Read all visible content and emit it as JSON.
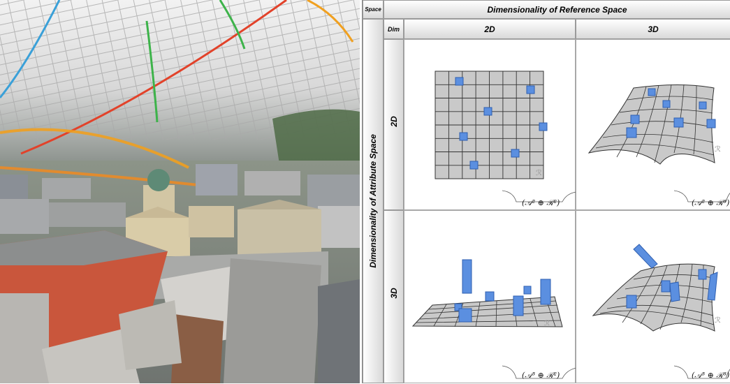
{
  "matrix": {
    "corner_label": "Space",
    "reference_header": "Dimensionality of Reference Space",
    "dim_label": "Dim",
    "attribute_header": "Dimensionality of Attribute Space",
    "columns": [
      "2D",
      "3D"
    ],
    "rows": [
      "2D",
      "3D"
    ],
    "cells": [
      {
        "row": "2D",
        "col": "2D",
        "formula": "(𝒜² ⊕ ℛ²)"
      },
      {
        "row": "2D",
        "col": "3D",
        "formula": "(𝒜² ⊕ ℛ³)"
      },
      {
        "row": "3D",
        "col": "2D",
        "formula": "(𝒜³ ⊕ ℛ²)"
      },
      {
        "row": "3D",
        "col": "3D",
        "formula": "(𝒜³ ⊕ ℛ³)"
      }
    ],
    "watermark_glyph": "ℛ"
  },
  "colors": {
    "grid_fill": "#c9c9c9",
    "grid_line": "#333333",
    "marker_fill": "#5b8fe0",
    "marker_dark": "#2f5fb0",
    "header_grad_top": "#ffffff",
    "header_grad_bottom": "#d9d9d9"
  }
}
